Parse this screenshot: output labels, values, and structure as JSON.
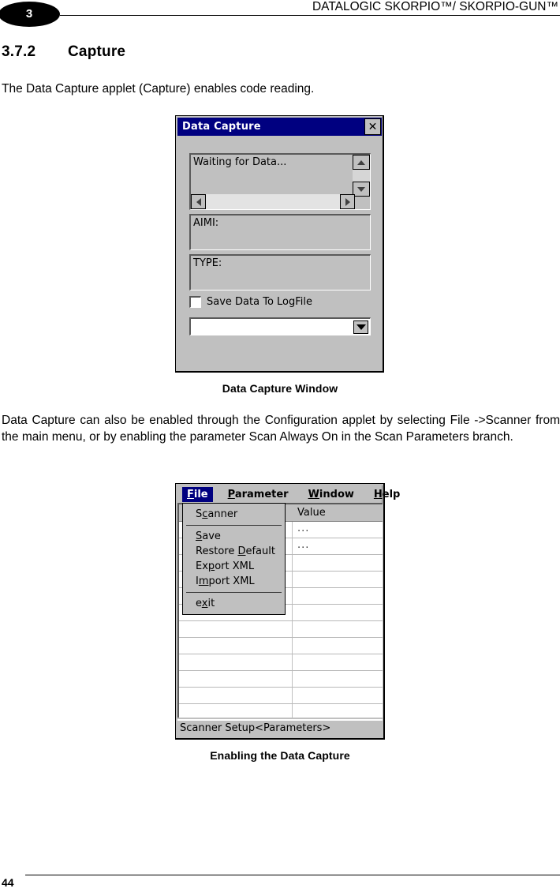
{
  "header": {
    "chapter_number": "3",
    "title": "DATALOGIC SKORPIO™/ SKORPIO-GUN™"
  },
  "section": {
    "number": "3.7.2",
    "title": "Capture"
  },
  "paragraphs": {
    "intro": "The Data Capture applet (Capture) enables code reading.",
    "enabling": "Data Capture can also be enabled through the Configuration applet by selecting File ->Scanner from the main menu, or by enabling the parameter Scan Always On in the Scan Parameters branch."
  },
  "figures": {
    "caption_1": "Data Capture Window",
    "caption_2": "Enabling the Data Capture"
  },
  "footer": {
    "page_number": "44"
  },
  "colors": {
    "titlebar": "#000080",
    "window_face": "#c0c0c0",
    "menu_highlight": "#000080",
    "field_white": "#ffffff"
  },
  "data_capture_window": {
    "title": "Data Capture",
    "close_label": "✕",
    "output_text": "Waiting for Data...",
    "aimi_label": "AIMI:",
    "type_label": "TYPE:",
    "checkbox_label": "Save Data To LogFile",
    "checkbox_checked": false,
    "combo_value": ""
  },
  "scanner_setup_window": {
    "menubar": [
      {
        "label": "File",
        "accel": "F",
        "active": true
      },
      {
        "label": "Parameter",
        "accel": "P",
        "active": false
      },
      {
        "label": "Window",
        "accel": "W",
        "active": false
      },
      {
        "label": "Help",
        "accel": "H",
        "active": false
      }
    ],
    "file_menu": [
      {
        "label": "Scanner",
        "accel": "c",
        "separator_after": true
      },
      {
        "label": "Save",
        "accel": "S",
        "separator_after": false
      },
      {
        "label": "Restore Default",
        "accel": "D",
        "separator_after": false
      },
      {
        "label": "Export XML",
        "accel": "p",
        "separator_after": false
      },
      {
        "label": "Import XML",
        "accel": "m",
        "separator_after": true
      },
      {
        "label": "exit",
        "accel": "x",
        "separator_after": false
      }
    ],
    "table": {
      "column_headers": [
        "",
        "Value"
      ],
      "rows": [
        {
          "name": "",
          "value": "..."
        },
        {
          "name": "",
          "value": "..."
        },
        {
          "name": "",
          "value": ""
        },
        {
          "name": "",
          "value": ""
        },
        {
          "name": "",
          "value": ""
        },
        {
          "name": "",
          "value": ""
        },
        {
          "name": "",
          "value": ""
        },
        {
          "name": "",
          "value": ""
        },
        {
          "name": "",
          "value": ""
        },
        {
          "name": "",
          "value": ""
        },
        {
          "name": "",
          "value": ""
        },
        {
          "name": "",
          "value": ""
        }
      ]
    },
    "status_text": "Scanner Setup<Parameters>"
  }
}
